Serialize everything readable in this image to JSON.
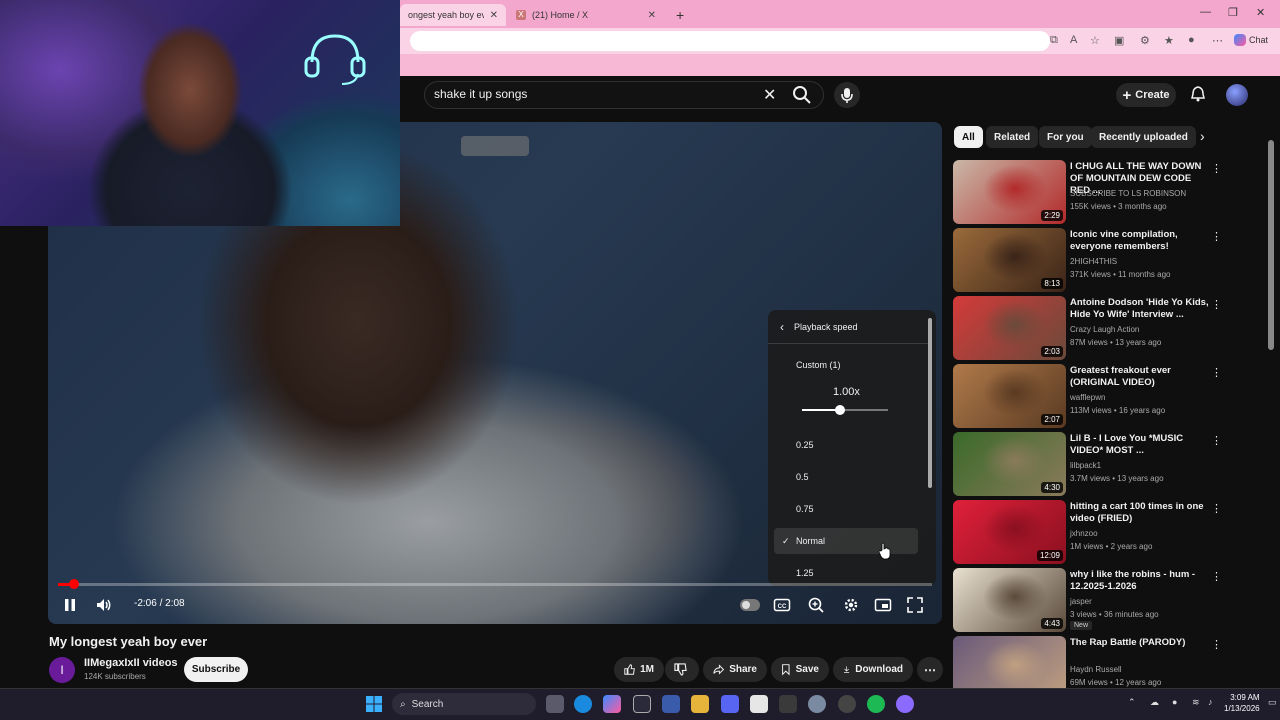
{
  "browser": {
    "tabs": [
      {
        "label": "ongest yeah boy ever - Yo",
        "active": true
      },
      {
        "label": "(21) Home / X",
        "active": false
      }
    ],
    "new_tab": "+",
    "chat_label": "Chat"
  },
  "header": {
    "search_value": "shake it up songs",
    "create_label": "Create"
  },
  "player": {
    "time_display": "-2:06 / 2:08",
    "progress_fraction": 0.018,
    "settings": {
      "title": "Playback speed",
      "custom_label": "Custom (1)",
      "custom_value": "1.00x",
      "speed_fraction": 0.44,
      "options": [
        "0.25",
        "0.5",
        "0.75",
        "Normal",
        "1.25"
      ],
      "selected": "Normal"
    }
  },
  "video": {
    "title": "My longest yeah boy ever",
    "channel_initial": "I",
    "channel_name": "IIMegaxIxII videos",
    "subscribers": "124K subscribers",
    "subscribe_label": "Subscribe",
    "likes": "1M",
    "share_label": "Share",
    "save_label": "Save",
    "download_label": "Download"
  },
  "sidebar": {
    "chips": [
      {
        "label": "All",
        "active": true
      },
      {
        "label": "Related",
        "active": false
      },
      {
        "label": "For you",
        "active": false
      },
      {
        "label": "Recently uploaded",
        "active": false
      }
    ],
    "recommendations": [
      {
        "title": "I CHUG ALL THE WAY DOWN OF MOUNTAIN DEW CODE RED ...",
        "channel": "SUBSCRIBE TO LS ROBINSON",
        "meta": "155K views • 3 months ago",
        "duration": "2:29",
        "colors": [
          "#c9b8a8",
          "#b22a2a"
        ]
      },
      {
        "title": "Iconic vine compilation, everyone remembers!",
        "channel": "2HIGH4THIS",
        "meta": "371K views • 11 months ago",
        "duration": "8:13",
        "colors": [
          "#9a6a3a",
          "#3a2418"
        ]
      },
      {
        "title": "Antoine Dodson 'Hide Yo Kids, Hide Yo Wife' Interview ...",
        "channel": "Crazy Laugh Action",
        "meta": "87M views • 13 years ago",
        "duration": "2:03",
        "colors": [
          "#d43a3a",
          "#6a4a3a"
        ]
      },
      {
        "title": "Greatest freakout ever (ORIGINAL VIDEO)",
        "channel": "wafflepwn",
        "meta": "113M views • 16 years ago",
        "duration": "2:07",
        "colors": [
          "#b07a4a",
          "#5a3a22"
        ]
      },
      {
        "title": "Lil B - I Love You *MUSIC VIDEO* MOST ...",
        "channel": "lilbpack1",
        "meta": "3.7M views • 13 years ago",
        "duration": "4:30",
        "colors": [
          "#3a6a2a",
          "#8a7a5a"
        ]
      },
      {
        "title": "hitting a cart 100 times in one video (FRIED)",
        "channel": "jxhnzoo",
        "meta": "1M views • 2 years ago",
        "duration": "12:09",
        "colors": [
          "#e0203a",
          "#8a1020"
        ]
      },
      {
        "title": "why i like the robins - hum - 12.2025-1.2026",
        "channel": "jasper",
        "meta": "3 views • 36 minutes ago",
        "duration": "4:43",
        "badge": "New",
        "colors": [
          "#e8e0d0",
          "#5a4a3a"
        ]
      },
      {
        "title": "The Rap Battle (PARODY)",
        "channel": "Haydn Russell",
        "meta": "69M views • 12 years ago",
        "duration": "",
        "colors": [
          "#6a5a7a",
          "#c0a080"
        ]
      }
    ]
  },
  "taskbar": {
    "search_label": "Search",
    "time": "3:09 AM",
    "date": "1/13/2026"
  }
}
